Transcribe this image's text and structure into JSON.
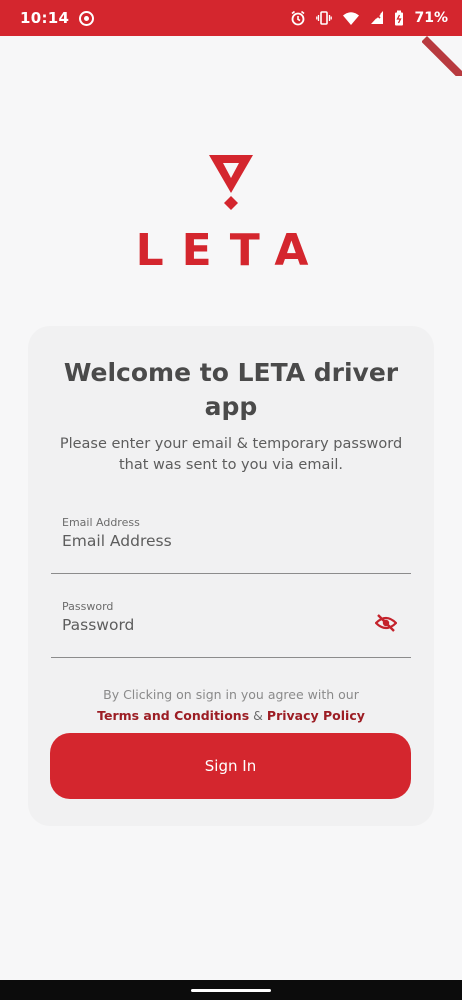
{
  "status_bar": {
    "time": "10:14",
    "battery": "71%",
    "icons": [
      "vpn-icon",
      "alarm-icon",
      "vibrate-icon",
      "wifi-icon",
      "signal-icon",
      "battery-icon"
    ]
  },
  "brand": {
    "name": "LETA",
    "color": "#d4262e"
  },
  "card": {
    "title": "Welcome to LETA driver app",
    "subtitle": "Please enter your email & temporary password that was sent to you via email."
  },
  "form": {
    "email": {
      "label": "Email Address",
      "placeholder": "Email Address"
    },
    "password": {
      "label": "Password",
      "placeholder": "Password",
      "visibility_icon": "eye-off-icon"
    }
  },
  "terms": {
    "prefix": "By Clicking on sign in you agree with our",
    "terms_link": "Terms and Conditions",
    "separator": "&",
    "privacy_link": "Privacy Policy"
  },
  "actions": {
    "sign_in_label": "Sign In"
  }
}
